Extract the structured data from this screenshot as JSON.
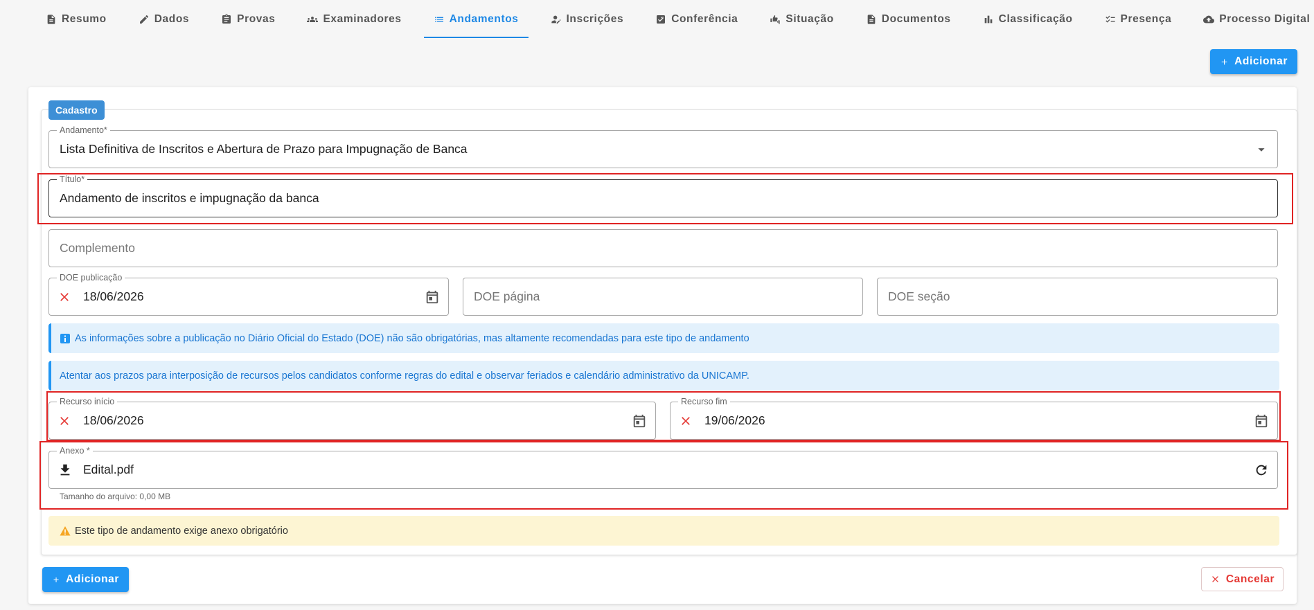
{
  "tabs": [
    {
      "label": "Resumo",
      "icon": "document-icon"
    },
    {
      "label": "Dados",
      "icon": "pencil-icon"
    },
    {
      "label": "Provas",
      "icon": "clipboard-icon"
    },
    {
      "label": "Examinadores",
      "icon": "group-icon"
    },
    {
      "label": "Andamentos",
      "icon": "list-icon",
      "active": true
    },
    {
      "label": "Inscrições",
      "icon": "person-edit-icon"
    },
    {
      "label": "Conferência",
      "icon": "checklist-box-icon"
    },
    {
      "label": "Situação",
      "icon": "thumbs-icon"
    },
    {
      "label": "Documentos",
      "icon": "file-icon"
    },
    {
      "label": "Classificação",
      "icon": "bar-chart-icon"
    },
    {
      "label": "Presença",
      "icon": "checklist-icon"
    },
    {
      "label": "Processo Digital",
      "icon": "cloud-upload-icon"
    }
  ],
  "top_add_label": "Adicionar",
  "section_label": "Cadastro",
  "andamento": {
    "label": "Andamento*",
    "value": "Lista Definitiva de Inscritos e Abertura de Prazo para Impugnação de Banca"
  },
  "titulo": {
    "label": "Título*",
    "value": "Andamento de inscritos e impugnação da banca"
  },
  "complemento": {
    "placeholder": "Complemento"
  },
  "doe_publicacao": {
    "label": "DOE publicação",
    "value": "18/06/2026"
  },
  "doe_pagina": {
    "placeholder": "DOE página"
  },
  "doe_secao": {
    "placeholder": "DOE seção"
  },
  "info_doe": "As informações sobre a publicação no Diário Oficial do Estado (DOE) não são obrigatórias, mas altamente recomendadas para este tipo de andamento",
  "info_prazos": "Atentar aos prazos para interposição de recursos pelos candidatos conforme regras do edital e observar feriados e calendário administrativo da UNICAMP.",
  "recurso_inicio": {
    "label": "Recurso início",
    "value": "18/06/2026"
  },
  "recurso_fim": {
    "label": "Recurso fim",
    "value": "19/06/2026"
  },
  "anexo": {
    "label": "Anexo *",
    "value": "Edital.pdf",
    "hint": "Tamanho do arquivo: 0,00 MB"
  },
  "warn_anexo": "Este tipo de andamento exige anexo obrigatório",
  "bottom_add_label": "Adicionar",
  "cancel_label": "Cancelar",
  "colors": {
    "accent": "#2196f3",
    "danger": "#e53935",
    "highlight": "#e02424"
  }
}
